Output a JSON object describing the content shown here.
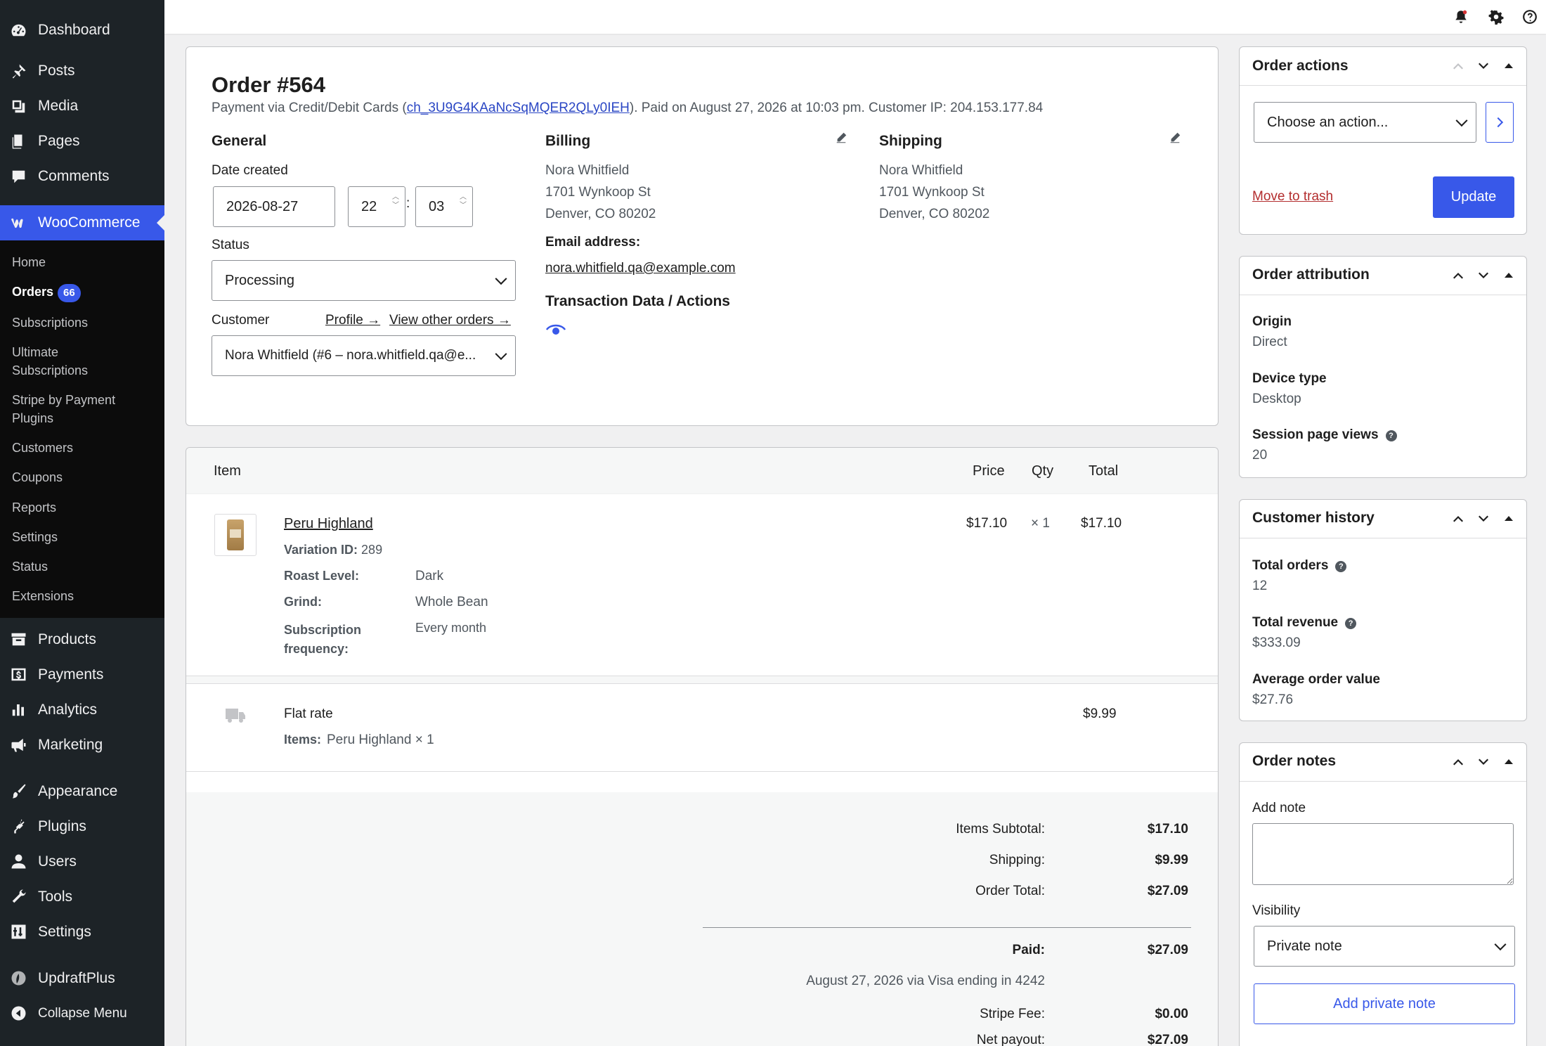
{
  "sidebar": {
    "dashboard": "Dashboard",
    "posts": "Posts",
    "media": "Media",
    "pages": "Pages",
    "comments": "Comments",
    "woocommerce": "WooCommerce",
    "woo_sub": {
      "home": "Home",
      "orders": "Orders",
      "orders_count": "66",
      "subscriptions": "Subscriptions",
      "ultimate_subscriptions": "Ultimate Subscriptions",
      "stripe": "Stripe by Payment Plugins",
      "customers": "Customers",
      "coupons": "Coupons",
      "reports": "Reports",
      "settings": "Settings",
      "status": "Status",
      "extensions": "Extensions"
    },
    "products": "Products",
    "payments": "Payments",
    "analytics": "Analytics",
    "marketing": "Marketing",
    "appearance": "Appearance",
    "plugins": "Plugins",
    "users": "Users",
    "tools": "Tools",
    "settings": "Settings",
    "updraftplus": "UpdraftPlus",
    "collapse": "Collapse Menu"
  },
  "order": {
    "title": "Order #564",
    "meta_prefix": "Payment via Credit/Debit Cards (",
    "charge_id": "ch_3U9G4KAaNcSqMQER2QLy0IEH",
    "meta_suffix": "). Paid on August 27, 2026 at 10:03 pm. Customer IP: 204.153.177.84",
    "general": {
      "heading": "General",
      "date_label": "Date created",
      "date": "2026-08-27",
      "hour": "22",
      "minute": "03",
      "colon": ":",
      "status_label": "Status",
      "status": "Processing",
      "customer_label": "Customer",
      "profile_link": "Profile →",
      "other_orders_link": "View other orders →",
      "customer": "Nora Whitfield (#6 – nora.whitfield.qa@e..."
    },
    "billing": {
      "heading": "Billing",
      "name": "Nora Whitfield",
      "street": "1701 Wynkoop St",
      "city": "Denver, CO 80202",
      "email_label": "Email address:",
      "email": "nora.whitfield.qa@example.com",
      "transaction_heading": "Transaction Data / Actions"
    },
    "shipping": {
      "heading": "Shipping",
      "name": "Nora Whitfield",
      "street": "1701 Wynkoop St",
      "city": "Denver, CO 80202"
    }
  },
  "items": {
    "headers": {
      "item": "Item",
      "price": "Price",
      "qty": "Qty",
      "total": "Total"
    },
    "product": {
      "name": "Peru Highland",
      "variation_label": "Variation ID:",
      "variation_id": "289",
      "price": "$17.10",
      "qty": "× 1",
      "total": "$17.10",
      "meta": [
        {
          "key": "Roast Level:",
          "value": "Dark"
        },
        {
          "key": "Grind:",
          "value": "Whole Bean"
        },
        {
          "key": "Subscription frequency:",
          "value": "Every month"
        }
      ]
    },
    "shipping_line": {
      "name": "Flat rate",
      "items_label": "Items:",
      "items": "Peru Highland × 1",
      "total": "$9.99"
    },
    "totals": {
      "subtotal_label": "Items Subtotal:",
      "subtotal": "$17.10",
      "shipping_label": "Shipping:",
      "shipping": "$9.99",
      "order_total_label": "Order Total:",
      "order_total": "$27.09",
      "paid_label": "Paid:",
      "paid": "$27.09",
      "paid_note": "August 27, 2026 via Visa ending in 4242",
      "fee_label": "Stripe Fee:",
      "fee": "$0.00",
      "payout_label": "Net payout:",
      "payout": "$27.09"
    }
  },
  "order_actions": {
    "title": "Order actions",
    "select": "Choose an action...",
    "trash": "Move to trash",
    "update": "Update"
  },
  "attribution": {
    "title": "Order attribution",
    "origin_label": "Origin",
    "origin": "Direct",
    "device_label": "Device type",
    "device": "Desktop",
    "views_label": "Session page views",
    "views": "20"
  },
  "history": {
    "title": "Customer history",
    "orders_label": "Total orders",
    "orders": "12",
    "revenue_label": "Total revenue",
    "revenue": "$333.09",
    "aov_label": "Average order value",
    "aov": "$27.76"
  },
  "notes": {
    "title": "Order notes",
    "add_label": "Add note",
    "visibility_label": "Visibility",
    "visibility": "Private note",
    "add_button": "Add private note"
  },
  "colors": {
    "accent": "#3858e9",
    "sidebar": "#1d2327",
    "link": "#2a46c4",
    "trash": "#b32d2e"
  }
}
